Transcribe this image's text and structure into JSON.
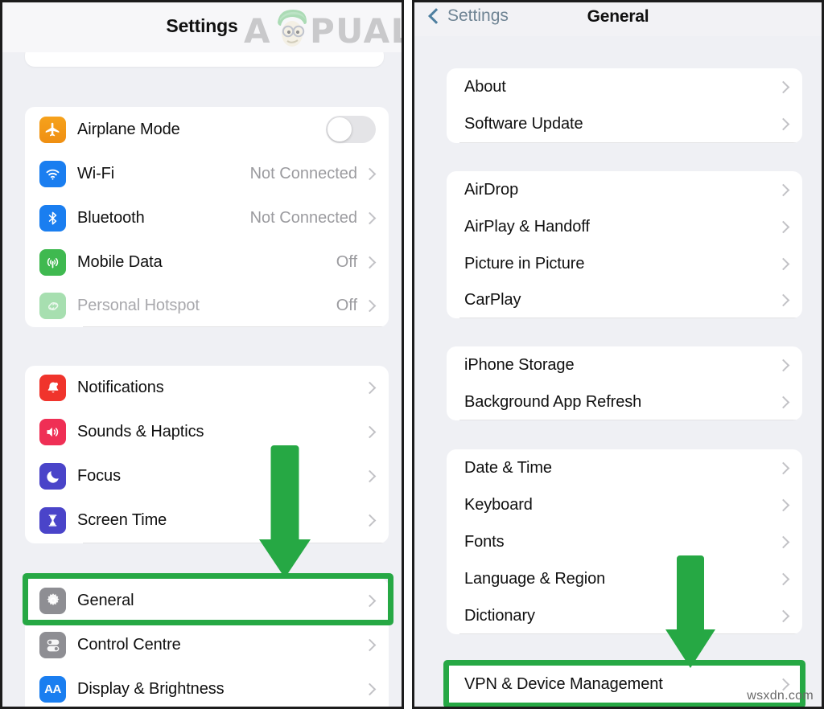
{
  "watermark": {
    "brand_prefix": "A",
    "brand_suffix": "PUALS",
    "corner_text": "wsxdn.com"
  },
  "left_panel": {
    "header": {
      "title": "Settings"
    },
    "groups": [
      {
        "name": "connectivity",
        "rows": [
          {
            "label": "Airplane Mode",
            "icon": "airplane-icon",
            "control": "toggle",
            "toggle_on": false
          },
          {
            "label": "Wi-Fi",
            "icon": "wifi-icon",
            "value": "Not Connected",
            "control": "chevron"
          },
          {
            "label": "Bluetooth",
            "icon": "bluetooth-icon",
            "value": "Not Connected",
            "control": "chevron"
          },
          {
            "label": "Mobile Data",
            "icon": "cellular-icon",
            "value": "Off",
            "control": "chevron"
          },
          {
            "label": "Personal Hotspot",
            "icon": "hotspot-icon",
            "value": "Off",
            "control": "chevron",
            "dim": true
          }
        ]
      },
      {
        "name": "alerts",
        "rows": [
          {
            "label": "Notifications",
            "icon": "bell-icon",
            "control": "chevron"
          },
          {
            "label": "Sounds & Haptics",
            "icon": "speaker-icon",
            "control": "chevron"
          },
          {
            "label": "Focus",
            "icon": "moon-icon",
            "control": "chevron"
          },
          {
            "label": "Screen Time",
            "icon": "hourglass-icon",
            "control": "chevron"
          }
        ]
      },
      {
        "name": "system",
        "rows": [
          {
            "label": "General",
            "icon": "gear-icon",
            "control": "chevron",
            "highlighted": true
          },
          {
            "label": "Control Centre",
            "icon": "control-centre-icon",
            "control": "chevron"
          },
          {
            "label": "Display & Brightness",
            "icon": "display-brightness-icon",
            "control": "chevron"
          }
        ]
      }
    ]
  },
  "right_panel": {
    "header": {
      "back_label": "Settings",
      "title": "General"
    },
    "groups": [
      {
        "name": "info",
        "rows": [
          {
            "label": "About"
          },
          {
            "label": "Software Update"
          }
        ]
      },
      {
        "name": "sharing",
        "rows": [
          {
            "label": "AirDrop"
          },
          {
            "label": "AirPlay & Handoff"
          },
          {
            "label": "Picture in Picture"
          },
          {
            "label": "CarPlay"
          }
        ]
      },
      {
        "name": "storage",
        "rows": [
          {
            "label": "iPhone Storage"
          },
          {
            "label": "Background App Refresh"
          }
        ]
      },
      {
        "name": "locale",
        "rows": [
          {
            "label": "Date & Time"
          },
          {
            "label": "Keyboard"
          },
          {
            "label": "Fonts"
          },
          {
            "label": "Language & Region"
          },
          {
            "label": "Dictionary"
          }
        ]
      },
      {
        "name": "management",
        "rows": [
          {
            "label": "VPN & Device Management",
            "highlighted": true
          }
        ]
      }
    ]
  },
  "annotations": {
    "accent_color": "#26a844",
    "left_arrow": "down-arrow-pointing-to-general",
    "right_arrow": "down-arrow-pointing-to-vpn-device-management",
    "left_box": "highlight-general-row",
    "right_box": "highlight-vpn-device-management-row"
  }
}
